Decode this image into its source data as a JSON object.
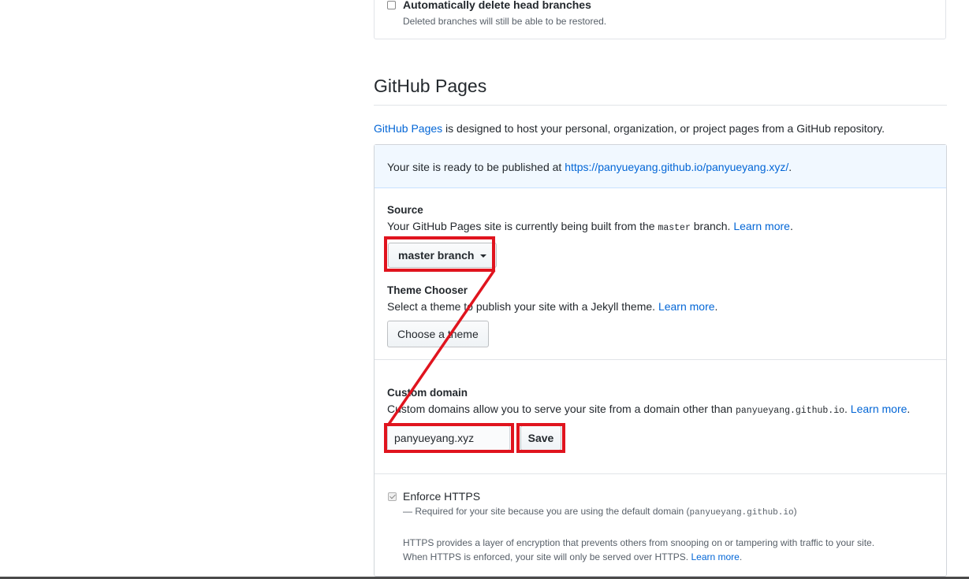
{
  "auto_delete": {
    "title": "Automatically delete head branches",
    "note": "Deleted branches will still be able to be restored.",
    "checked": false
  },
  "pages": {
    "title": "GitHub Pages",
    "intro_link": "GitHub Pages",
    "intro_text": " is designed to host your personal, organization, or project pages from a GitHub repository.",
    "flash_text": "Your site is ready to be published at ",
    "flash_link": "https://panyueyang.github.io/panyueyang.xyz/",
    "flash_end": "."
  },
  "source": {
    "label": "Source",
    "desc_a": "Your GitHub Pages site is currently being built from the ",
    "branch_code": "master",
    "desc_b": " branch. ",
    "learn_more": "Learn more",
    "end": ".",
    "dropdown_label": "master branch"
  },
  "theme": {
    "label": "Theme Chooser",
    "desc": "Select a theme to publish your site with a Jekyll theme. ",
    "learn_more": "Learn more",
    "end": ".",
    "button_label": "Choose a theme"
  },
  "custom_domain": {
    "label": "Custom domain",
    "desc": "Custom domains allow you to serve your site from a domain other than ",
    "domain_code": "panyueyang.github.io",
    "desc_end": ". ",
    "learn_more": "Learn more",
    "end": ".",
    "input_value": "panyueyang.xyz",
    "save_label": "Save"
  },
  "https": {
    "title": "Enforce HTTPS",
    "checked": true,
    "required_text": "— Required for your site because you are using the default domain (",
    "required_code": "panyueyang.github.io",
    "required_end": ")",
    "info_1": "HTTPS provides a layer of encryption that prevents others from snooping on or tampering with traffic to your site.",
    "info_2": "When HTTPS is enforced, your site will only be served over HTTPS. ",
    "learn_more": "Learn more",
    "end": "."
  },
  "colors": {
    "link": "#0366d6",
    "annotation": "#e0141e",
    "flash_bg": "#f1f8ff"
  }
}
